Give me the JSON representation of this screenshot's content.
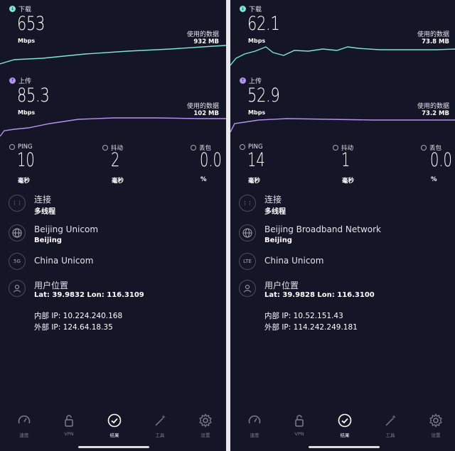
{
  "panels": [
    {
      "download": {
        "label": "下载",
        "value": "653",
        "unit": "Mbps",
        "used_label": "使用的数据",
        "used_value": "932 MB"
      },
      "upload": {
        "label": "上传",
        "value": "85.3",
        "unit": "Mbps",
        "used_label": "使用的数据",
        "used_value": "102 MB"
      },
      "ping": {
        "label": "PING",
        "value": "10",
        "unit": "毫秒"
      },
      "jitter": {
        "label": "抖动",
        "value": "2",
        "unit": "毫秒"
      },
      "loss": {
        "label": "丢包",
        "value": "0.0",
        "unit": "%"
      },
      "connection": {
        "title": "连接",
        "value": "多线程"
      },
      "isp": {
        "title": "Beijing Unicom",
        "value": "Beijing"
      },
      "provider": {
        "badge": "5G",
        "title": "China Unicom"
      },
      "location": {
        "title": "用户位置",
        "latlon": "Lat: 39.9832 Lon: 116.3109",
        "internal_ip": "内部 IP: 10.224.240.168",
        "external_ip": "外部 IP: 124.64.18.35"
      }
    },
    {
      "download": {
        "label": "下载",
        "value": "62.1",
        "unit": "Mbps",
        "used_label": "使用的数据",
        "used_value": "73.8 MB"
      },
      "upload": {
        "label": "上传",
        "value": "52.9",
        "unit": "Mbps",
        "used_label": "使用的数据",
        "used_value": "73.2 MB"
      },
      "ping": {
        "label": "PING",
        "value": "14",
        "unit": "毫秒"
      },
      "jitter": {
        "label": "抖动",
        "value": "1",
        "unit": "毫秒"
      },
      "loss": {
        "label": "丢包",
        "value": "0.0",
        "unit": "%"
      },
      "connection": {
        "title": "连接",
        "value": "多线程"
      },
      "isp": {
        "title": "Beijing Broadband Network",
        "value": "Beijing"
      },
      "provider": {
        "badge": "LTE",
        "title": "China Unicom"
      },
      "location": {
        "title": "用户位置",
        "latlon": "Lat: 39.9828 Lon: 116.3100",
        "internal_ip": "内部 IP: 10.52.151.43",
        "external_ip": "外部 IP: 114.242.249.181"
      }
    }
  ],
  "nav": [
    {
      "label": "速度",
      "icon": "speedometer-icon"
    },
    {
      "label": "VPN",
      "icon": "lock-icon"
    },
    {
      "label": "结果",
      "icon": "check-circle-icon",
      "active": true
    },
    {
      "label": "工具",
      "icon": "magic-wand-icon"
    },
    {
      "label": "设置",
      "icon": "gear-icon"
    }
  ],
  "colors": {
    "background": "#141526",
    "download_line": "#7fe5d4",
    "upload_line": "#b493f2"
  }
}
